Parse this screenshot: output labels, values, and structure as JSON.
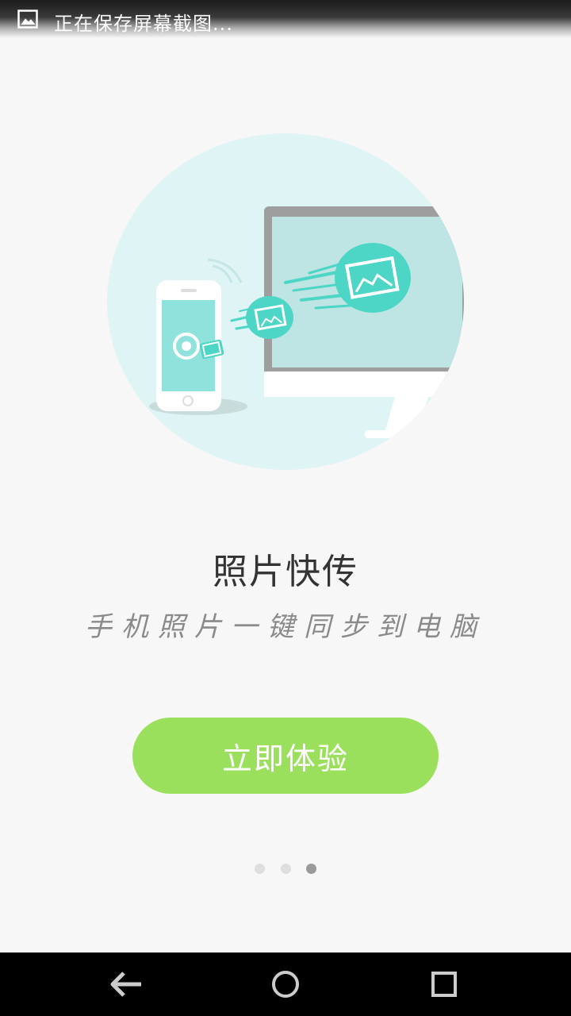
{
  "status_bar": {
    "notification_text": "正在保存屏幕截图...",
    "icon": "image-icon"
  },
  "onboarding": {
    "title": "照片快传",
    "subtitle": "手机照片一键同步到电脑",
    "start_button_label": "立即体验",
    "page_indicator": {
      "total": 3,
      "current": 3
    }
  },
  "navigation_bar": {
    "buttons": [
      "back-icon",
      "home-icon",
      "recents-icon"
    ]
  },
  "colors": {
    "background": "#f7f7f7",
    "accent_green": "#9be05c",
    "illustration_teal": "#4dd6c6",
    "circle_bg": "#dff4f5"
  }
}
